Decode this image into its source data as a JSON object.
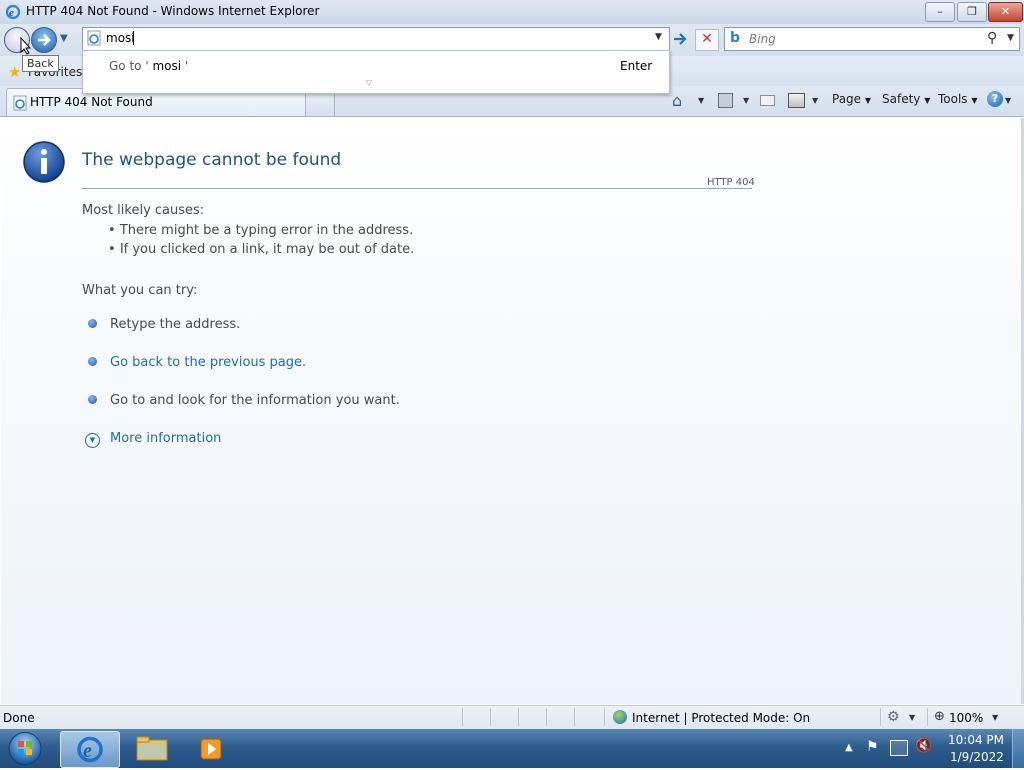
{
  "window": {
    "title": "HTTP 404 Not Found - Windows Internet Explorer"
  },
  "nav": {
    "address_value": "mosi",
    "search_placeholder": "Bing",
    "back_tooltip": "Back"
  },
  "dropdown": {
    "go_prefix": "Go to '",
    "go_value": " mosi ",
    "go_suffix": "'",
    "enter_hint": "Enter"
  },
  "favorites": {
    "label": "Favorites"
  },
  "tab": {
    "title": "HTTP 404 Not Found"
  },
  "commands": {
    "page": "Page",
    "safety": "Safety",
    "tools": "Tools"
  },
  "error_page": {
    "heading": "The webpage cannot be found",
    "code": "HTTP 404",
    "causes_heading": "Most likely causes:",
    "causes": [
      "There might be a typing error in the address.",
      "If you clicked on a link, it may be out of date."
    ],
    "try_heading": "What you can try:",
    "try_items": [
      "Retype the address.",
      "Go back to the previous page.",
      "Go to  and look for the information you want."
    ],
    "more_info": "More information"
  },
  "status": {
    "left": "Done",
    "zone": "Internet | Protected Mode: On",
    "zoom": "100%"
  },
  "tray": {
    "time": "10:04 PM",
    "date": "1/9/2022"
  }
}
